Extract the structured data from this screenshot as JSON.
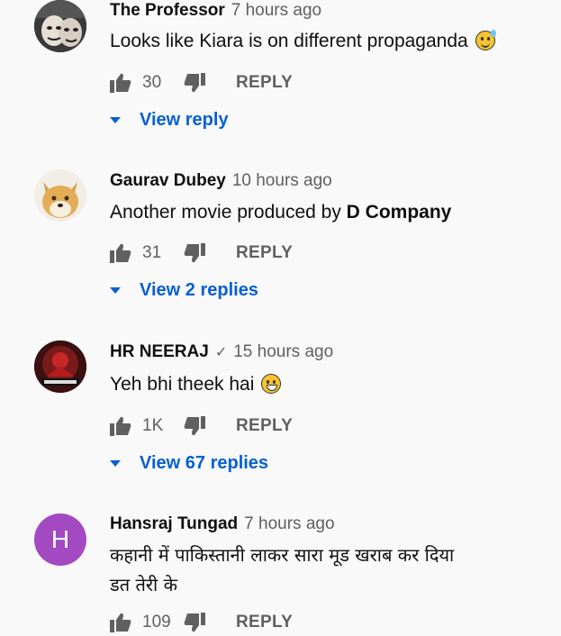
{
  "comments": [
    {
      "author": "The Professor",
      "time": "7 hours ago",
      "text": "Looks like Kiara is on different propaganda",
      "emoji": "sweat-smile-emoji",
      "likes": "30",
      "reply_label": "REPLY",
      "view_replies": "View reply"
    },
    {
      "author": "Gaurav Dubey",
      "time": "10 hours ago",
      "text_prefix": "Another movie produced by ",
      "text_bold": "D Company",
      "likes": "31",
      "reply_label": "REPLY",
      "view_replies": "View 2 replies"
    },
    {
      "author": "HR NEERAJ",
      "verified": "✓",
      "time": "15 hours ago",
      "text": "Yeh bhi theek hai",
      "emoji": "joy-emoji",
      "likes": "1K",
      "reply_label": "REPLY",
      "view_replies": "View 67 replies"
    },
    {
      "author": "Hansraj Tungad",
      "time": "7 hours ago",
      "avatar_letter": "H",
      "text_line1": "कहानी में पाकिस्तानी लाकर सारा मूड खराब कर दिया",
      "text_line2": "डत तेरी के",
      "likes": "109",
      "reply_label": "REPLY"
    }
  ],
  "colors": {
    "link": "#065fd4",
    "secondary_text": "#606060",
    "avatar_h": "#a349c2",
    "background": "#f9f9f9"
  }
}
